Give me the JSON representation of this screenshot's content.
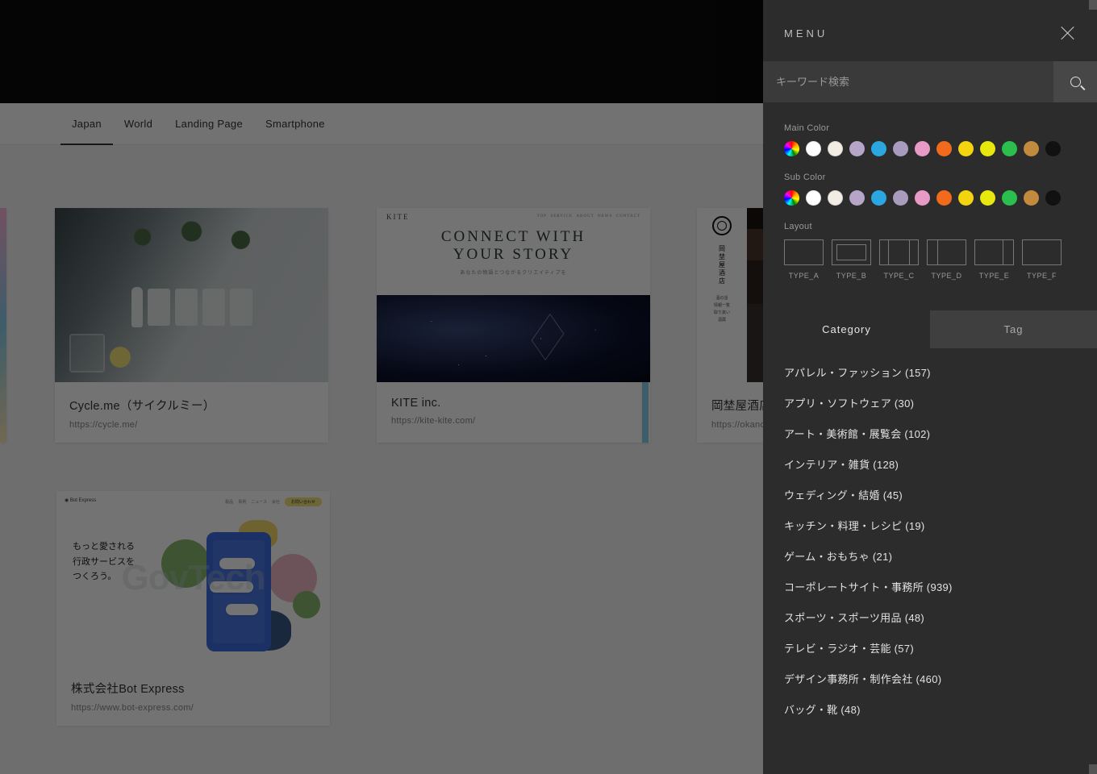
{
  "tabs": [
    "Japan",
    "World",
    "Landing Page",
    "Smartphone"
  ],
  "active_tab": 0,
  "cards": [
    {
      "title": "Cycle.me（サイクルミー）",
      "url": "https://cycle.me/"
    },
    {
      "title": "KITE inc.",
      "url": "https://kite-kite.com/"
    },
    {
      "title": "岡埜屋酒店",
      "url": "https://okanoyasaketen.com/"
    },
    {
      "title": "株式会社Bot Express",
      "url": "https://www.bot-express.com/"
    }
  ],
  "kite": {
    "headline1": "CONNECT WITH",
    "headline2": "YOUR STORY",
    "sub": "あなたの物語とつながるクリエイティブを",
    "logo": "KITE"
  },
  "bot": {
    "brand": "Bot Express",
    "line1": "もっと愛される",
    "line2": "行政サービスを",
    "line3": "つくろう。",
    "cta": "お問い合わせ"
  },
  "govtech": "GovTech",
  "menu": {
    "title": "MENU",
    "search_placeholder": "キーワード検索",
    "main_color_label": "Main Color",
    "sub_color_label": "Sub Color",
    "layout_label": "Layout",
    "colors": [
      "#ffffff",
      "#f2ede4",
      "#b6a5c7",
      "#2aa6e0",
      "#a89bbd",
      "#e89ac7",
      "#f26a1b",
      "#f4d40e",
      "#e8e80e",
      "#2bbf4e",
      "#c28a3d",
      "#111111"
    ],
    "layouts": [
      "TYPE_A",
      "TYPE_B",
      "TYPE_C",
      "TYPE_D",
      "TYPE_E",
      "TYPE_F"
    ],
    "subtabs": [
      "Category",
      "Tag"
    ],
    "active_subtab": 0,
    "categories": [
      "アパレル・ファッション (157)",
      "アプリ・ソフトウェア (30)",
      "アート・美術館・展覧会 (102)",
      "インテリア・雑貨 (128)",
      "ウェディング・結婚 (45)",
      "キッチン・料理・レシピ (19)",
      "ゲーム・おもちゃ (21)",
      "コーポレートサイト・事務所 (939)",
      "スポーツ・スポーツ用品 (48)",
      "テレビ・ラジオ・芸能 (57)",
      "デザイン事務所・制作会社 (460)",
      "バッグ・靴 (48)"
    ]
  }
}
